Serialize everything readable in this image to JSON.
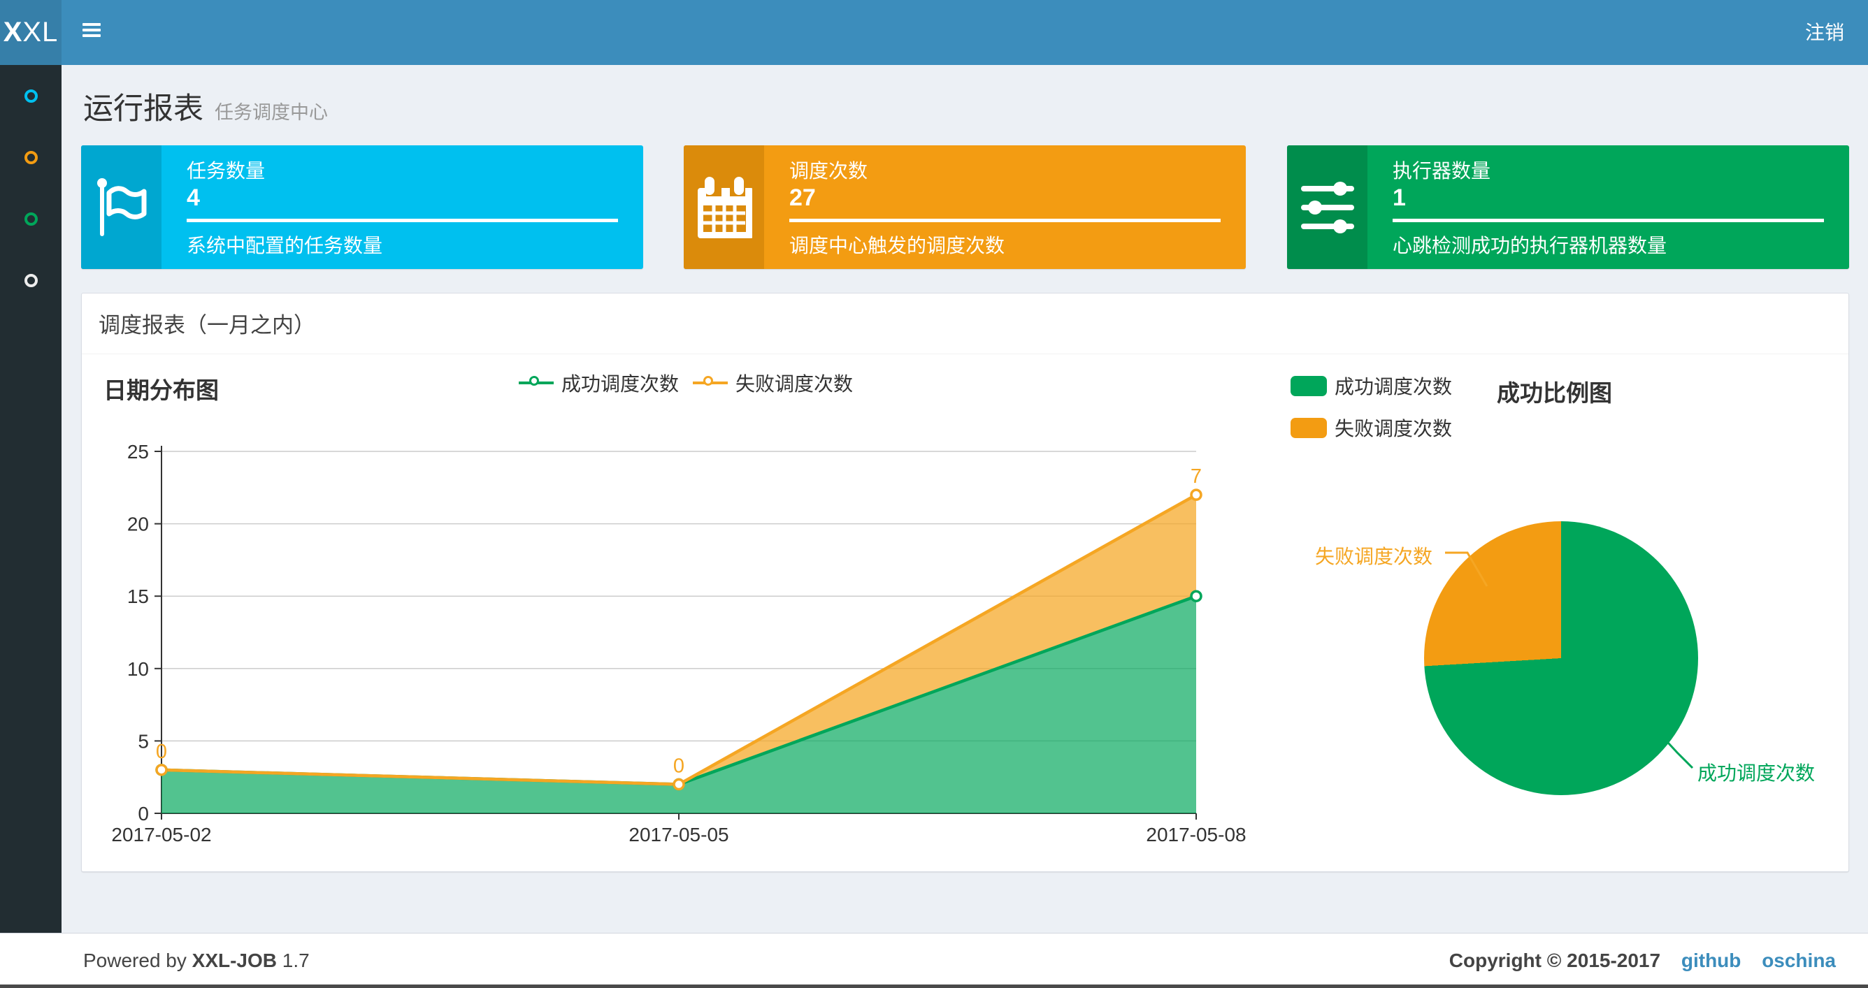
{
  "navbar": {
    "logo": {
      "bold": "X",
      "rest": "XL"
    },
    "logout_label": "注销"
  },
  "sidebar": {
    "items": [
      {
        "icon": "circle-outline-icon",
        "color": "#00c0ef"
      },
      {
        "icon": "circle-outline-icon",
        "color": "#f39c12"
      },
      {
        "icon": "circle-outline-icon",
        "color": "#00a65a"
      },
      {
        "icon": "circle-outline-icon",
        "color": "#ededed"
      }
    ]
  },
  "page_header": {
    "title": "运行报表",
    "subtitle": "任务调度中心"
  },
  "info_boxes": [
    {
      "icon": "flag-icon",
      "title": "任务数量",
      "value": "4",
      "desc": "系统中配置的任务数量",
      "bg": "#00c0ef",
      "icon_bg": "#00a7d0"
    },
    {
      "icon": "calendar-icon",
      "title": "调度次数",
      "value": "27",
      "desc": "调度中心触发的调度次数",
      "bg": "#f39c12",
      "icon_bg": "#db8b0b"
    },
    {
      "icon": "sliders-icon",
      "title": "执行器数量",
      "value": "1",
      "desc": "心跳检测成功的执行器机器数量",
      "bg": "#00a65a",
      "icon_bg": "#008d4c"
    }
  ],
  "panel": {
    "title": "调度报表（一月之内）"
  },
  "chart_data": [
    {
      "type": "area",
      "title": "日期分布图",
      "x": [
        "2017-05-02",
        "2017-05-05",
        "2017-05-08"
      ],
      "series": [
        {
          "name": "成功调度次数",
          "values": [
            3,
            2,
            15
          ],
          "color": "#00a65a"
        },
        {
          "name": "失败调度次数",
          "values": [
            0,
            0,
            7
          ],
          "color": "#f5a623",
          "data_labels": [
            "0",
            "0",
            "7"
          ]
        }
      ],
      "stacked": true,
      "ylim": [
        0,
        25
      ],
      "yticks": [
        0,
        5,
        10,
        15,
        20,
        25
      ],
      "grid": true,
      "legend_position": "top-center"
    },
    {
      "type": "pie",
      "title": "成功比例图",
      "slices": [
        {
          "name": "成功调度次数",
          "value": 20,
          "color": "#00a65a"
        },
        {
          "name": "失败调度次数",
          "value": 7,
          "color": "#f39c12"
        }
      ],
      "legend_position": "top-left"
    }
  ],
  "footer": {
    "powered_prefix": "Powered by",
    "product": "XXL-JOB",
    "version": "1.7",
    "copyright": "Copyright © 2015-2017",
    "links": [
      {
        "label": "github"
      },
      {
        "label": "oschina"
      }
    ]
  },
  "colors": {
    "navbar": "#3c8dbc",
    "logo_bg": "#367fa9",
    "sidebar_bg": "#222d32",
    "page_bg": "#ecf0f5",
    "aqua": "#00c0ef",
    "aqua_dark": "#00a7d0",
    "orange": "#f39c12",
    "orange_dark": "#db8b0b",
    "green": "#00a65a",
    "green_dark": "#008d4c",
    "chart_orange": "#f5a623",
    "link_blue": "#3c8dbc"
  }
}
